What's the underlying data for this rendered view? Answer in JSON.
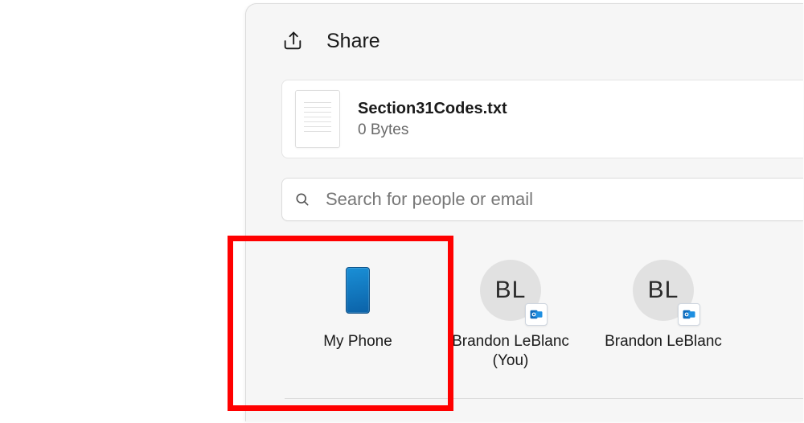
{
  "header": {
    "title": "Share"
  },
  "file": {
    "name": "Section31Codes.txt",
    "size": "0 Bytes"
  },
  "search": {
    "placeholder": "Search for people or email"
  },
  "targets": [
    {
      "kind": "phone",
      "label": "My Phone"
    },
    {
      "kind": "contact",
      "initials": "BL",
      "label": "Brandon LeBlanc (You)",
      "app": "outlook"
    },
    {
      "kind": "contact",
      "initials": "BL",
      "label": "Brandon LeBlanc",
      "app": "outlook"
    }
  ]
}
